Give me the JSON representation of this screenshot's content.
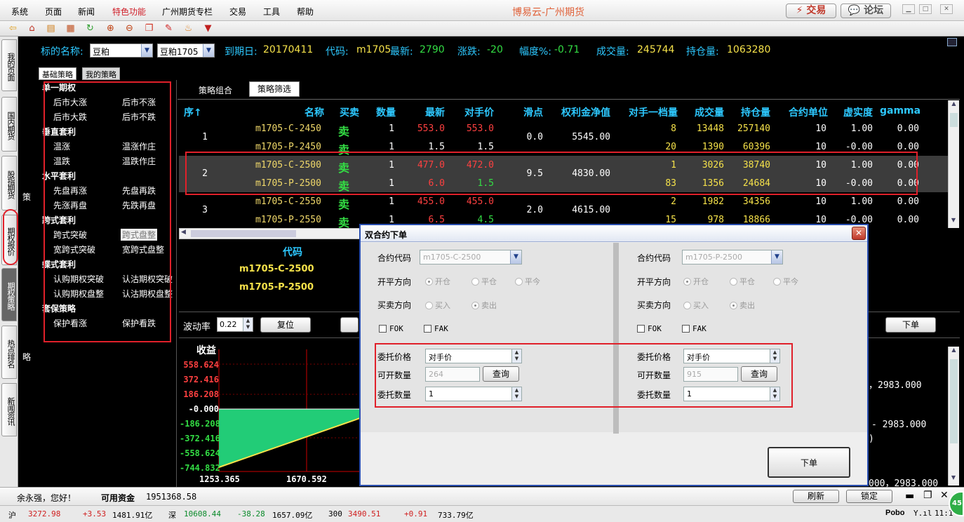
{
  "menu": {
    "items": [
      "系统",
      "页面",
      "新闻",
      "特色功能",
      "广州期货专栏",
      "交易",
      "工具",
      "帮助"
    ],
    "title": "博易云-广州期货",
    "trade_btn": "⚡ 交易",
    "forum_btn": "💬 论坛"
  },
  "toolbar": {
    "icons": [
      "back-arrow-icon",
      "home-icon",
      "book-icon",
      "list-icon",
      "refresh-icon",
      "zoom-in-icon",
      "zoom-out-icon",
      "windows-icon",
      "pen-icon",
      "paint-icon",
      "filter-icon"
    ]
  },
  "leftnav": {
    "tabs": [
      "我的页面",
      "国内期货",
      "股指期货",
      "期权报价",
      "期权策略",
      "热点排名",
      "新闻资讯"
    ]
  },
  "celane": {
    "top": "策",
    "bottom": "略"
  },
  "info": {
    "name_label": "标的名称:",
    "name_value": "豆粕",
    "contract_value": "豆粕1705",
    "expiry_label": "到期日:",
    "expiry_value": "20170411",
    "code_label": "代码:",
    "code_value": "m1705",
    "last_label": "最新:",
    "last_value": "2790",
    "change_label": "涨跌:",
    "change_value": "-20",
    "pct_label": "幅度%:",
    "pct_value": "-0.71",
    "volume_label": "成交量:",
    "volume_value": "245744",
    "oi_label": "持仓量:",
    "oi_value": "1063280"
  },
  "strategy_tabs": [
    "基础策略",
    "我的策略"
  ],
  "strategies": {
    "h1": "单一期权",
    "a1": "后市大涨",
    "a2": "后市不涨",
    "a3": "后市大跌",
    "a4": "后市不跌",
    "h2": "垂直套利",
    "b1": "温涨",
    "b2": "温涨作庄",
    "b3": "温跌",
    "b4": "温跌作庄",
    "h3": "水平套利",
    "c1": "先盘再涨",
    "c2": "先盘再跌",
    "c3": "先涨再盘",
    "c4": "先跌再盘",
    "h4": "跨式套利",
    "d1": "跨式突破",
    "d2": "跨式盘整",
    "d3": "宽跨式突破",
    "d4": "宽跨式盘整",
    "h5": "蝶式套利",
    "e1": "认购期权突破",
    "e2": "认沽期权突破",
    "e3": "认购期权盘整",
    "e4": "认沽期权盘整",
    "h6": "套保策略",
    "f1": "保护看涨",
    "f2": "保护看跌"
  },
  "subtabs": {
    "combo": "策略组合",
    "filter": "策略筛选"
  },
  "table": {
    "headers": [
      "序↑",
      "名称",
      "买卖",
      "数量",
      "最新",
      "对手价",
      "滑点",
      "权利金净值",
      "对手一档量",
      "成交量",
      "持仓量",
      "合约单位",
      "虚实度",
      "gamma"
    ],
    "groups": [
      {
        "seq": "1",
        "slip": "0.0",
        "premium": "5545.00",
        "rows": [
          {
            "name": "m1705-C-2450",
            "side": "卖",
            "qty": "1",
            "last": "553.0",
            "opp": "553.0",
            "opp_vol": "8",
            "vol": "13448",
            "oi": "257140",
            "unit": "10",
            "mny": "1.00",
            "gamma": "0.00"
          },
          {
            "name": "m1705-P-2450",
            "side": "卖",
            "qty": "1",
            "last": "1.5",
            "opp": "1.5",
            "opp_vol": "20",
            "vol": "1390",
            "oi": "60396",
            "unit": "10",
            "mny": "-0.00",
            "gamma": "0.00"
          }
        ]
      },
      {
        "seq": "2",
        "slip": "9.5",
        "premium": "4830.00",
        "rows": [
          {
            "name": "m1705-C-2500",
            "side": "卖",
            "qty": "1",
            "last": "477.0",
            "opp": "472.0",
            "opp_vol": "1",
            "vol": "3026",
            "oi": "38740",
            "unit": "10",
            "mny": "1.00",
            "gamma": "0.00"
          },
          {
            "name": "m1705-P-2500",
            "side": "卖",
            "qty": "1",
            "last": "6.0",
            "opp": "1.5",
            "opp_vol": "83",
            "vol": "1356",
            "oi": "24684",
            "unit": "10",
            "mny": "-0.00",
            "gamma": "0.00"
          }
        ]
      },
      {
        "seq": "3",
        "slip": "2.0",
        "premium": "4615.00",
        "rows": [
          {
            "name": "m1705-C-2550",
            "side": "卖",
            "qty": "1",
            "last": "455.0",
            "opp": "455.0",
            "opp_vol": "2",
            "vol": "1982",
            "oi": "34356",
            "unit": "10",
            "mny": "1.00",
            "gamma": "0.00"
          },
          {
            "name": "m1705-P-2550",
            "side": "卖",
            "qty": "1",
            "last": "6.5",
            "opp": "4.5",
            "opp_vol": "15",
            "vol": "978",
            "oi": "18866",
            "unit": "10",
            "mny": "-0.00",
            "gamma": "0.00"
          }
        ]
      }
    ]
  },
  "detail": {
    "code_header": "代码",
    "code1": "m1705-C-2500",
    "code2": "m1705-P-2500"
  },
  "controls": {
    "vol_label": "波动率",
    "vol_value": "0.22",
    "reset": "复位",
    "order": "下单"
  },
  "chart_data": {
    "type": "area",
    "title": "收益",
    "yticks": [
      "558.624",
      "372.416",
      "186.208",
      "-0.000",
      "-186.208",
      "-372.416",
      "-558.624",
      "-744.832"
    ],
    "xticks": [
      "1253.365",
      "1670.592"
    ]
  },
  "right_values": {
    "v1": "，2983.000",
    "v2": "- 2983.000",
    "v3": ")",
    "v4": "000，2983.000"
  },
  "dialog": {
    "title": "双合约下单",
    "left": {
      "code_label": "合约代码",
      "code": "m1705-C-2500",
      "oc_label": "开平方向",
      "open": "开仓",
      "close": "平仓",
      "close_today": "平今",
      "bs_label": "买卖方向",
      "buy": "买入",
      "sell": "卖出",
      "fok": "FOK",
      "fak": "FAK",
      "price_label": "委托价格",
      "price": "对手价",
      "avail_label": "可开数量",
      "avail": "264",
      "query": "查询",
      "qty_label": "委托数量",
      "qty": "1"
    },
    "right": {
      "code_label": "合约代码",
      "code": "m1705-P-2500",
      "oc_label": "开平方向",
      "open": "开仓",
      "close": "平仓",
      "close_today": "平今",
      "bs_label": "买卖方向",
      "buy": "买入",
      "sell": "卖出",
      "fok": "FOK",
      "fak": "FAK",
      "price_label": "委托价格",
      "price": "对手价",
      "avail_label": "可开数量",
      "avail": "915",
      "query": "查询",
      "qty_label": "委托数量",
      "qty": "1"
    },
    "submit": "下单"
  },
  "status": {
    "greet": "余永强，您好！",
    "funds_label": "可用资金",
    "funds": "1951368.58",
    "refresh": "刷新",
    "lock": "锁定"
  },
  "ticker": {
    "sh": "沪",
    "sh_val": "3272.98",
    "sh_chg": "+3.53",
    "sh_amt": "1481.91亿",
    "sz": "深",
    "sz_val": "10608.44",
    "sz_chg": "-38.28",
    "sz_amt": "1657.09亿",
    "i300": "300",
    "i300_val": "3490.51",
    "i300_chg": "+0.91",
    "i300_amt": "733.79亿",
    "brand": "Pobo",
    "time": "11:1",
    "badge": "45"
  }
}
